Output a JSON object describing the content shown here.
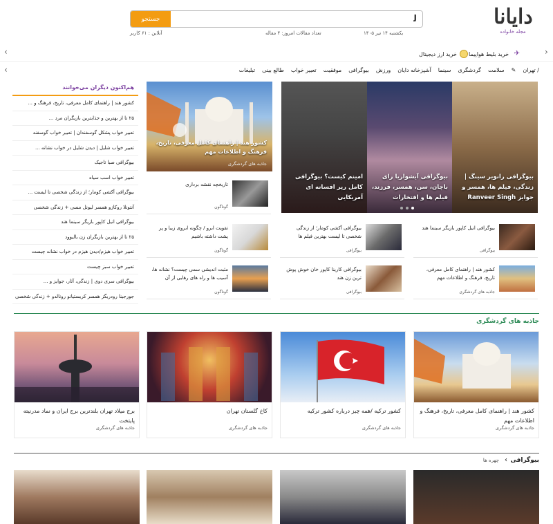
{
  "header": {
    "logo_text": "دایانا",
    "logo_subtitle": "مجله خانواده",
    "search_placeholder": "",
    "search_button": "جستجو",
    "date": "یکشنبه ۱۴ تیر ۱۴۰۵",
    "articles_today": "تعداد مقالات امروز: ۴ مقاله",
    "online": "آنلاین : ۶۱ کاربر"
  },
  "adbar": {
    "items": [
      "خرید بلیط هواپیما",
      "خرید ارز دیجیتال"
    ]
  },
  "nav": {
    "items": [
      "تهران /",
      "سلامت",
      "گردشگری",
      "سینما",
      "آشپزخانه دایان",
      "ورزش",
      "بیوگرافی",
      "موفقیت",
      "تعبیر خواب",
      "طالع بینی",
      "تبلیغات"
    ]
  },
  "slider": {
    "slides": [
      {
        "caption": "بیوگرافی رانویر سینگ | زندگی، فیلم ها، همسر و جوایز Ranveer Singh"
      },
      {
        "caption": "بیوگرافی آیشواریا رای باچان، سن، همسر، فرزند، فیلم ها و افتخارات"
      },
      {
        "caption": "امینم کیست؟ بیوگرافی کامل رپر افسانه ای آمریکایی"
      }
    ]
  },
  "feature": {
    "title": "کشور هند | راهنمای کامل معرفی، تاریخ، فرهنگ و اطلاعات مهم",
    "category": "جاذبه های گردشگری"
  },
  "cards": [
    {
      "title": "تاریخچه نقشه برداری",
      "category": "گوناگون"
    },
    {
      "title": "بیوگرافی انیل کاپور بازیگر سینما هند",
      "category": "بیوگرافی"
    },
    {
      "title": "بیوگرافی آکشی کومار؛ از زندگی شخصی تا لیست بهترین فیلم ها",
      "category": "بیوگرافی"
    },
    {
      "title": "تقویت ابرو / چگونه ابروی زیبا و پر پشت داشته باشیم",
      "category": "گوناگون"
    },
    {
      "title": "کشور هند | راهنمای کامل معرفی، تاریخ، فرهنگ و اطلاعات مهم",
      "category": "جاذبه های گردشگری"
    },
    {
      "title": "بیوگرافی کارینا کاپور خان خوش پوش ترین زن هند",
      "category": "بیوگرافی"
    },
    {
      "title": "مثبت اندیشی سمی چیست؟ نشانه ها، آسیب ها و راه های رهایی از آن",
      "category": "گوناگون"
    }
  ],
  "sidebar": {
    "title": "هم‌اکنون دیگران می‌خوانند",
    "items": [
      "کشور هند | راهنمای کامل معرفی، تاریخ، فرهنگ و ...",
      "۲۵ تا از بهترین و جذابترین بازیگران مرد ...",
      "تعبیر خواب پشکل گوسفندان | تعبیر خواب گوسفند",
      "تعبیر خواب شلیل | دیدن شلیل در خواب نشانه ...",
      "بیوگرافی صبا تاجیک",
      "تعبیر خواب اسب سیاه",
      "بیوگرافی آکشی کومار؛ از زندگی شخصی تا لیست ...",
      "آنتونلا روکازو همسر لیونل مسی + زندگی شخصی",
      "بیوگرافی انیل کاپور بازیگر سینما هند",
      "۲۵ تا از بهترین بازیگران زن بالیوود",
      "تعبیر خواب هیزم/دیدن هیزم در خواب نشانه چیست",
      "تعبیر خواب سبز چیست",
      "بیوگرافی سری دوی | زندگی، آثار، جوایز و ...",
      "جورجینا رودریگز همسر کریستیانو رونالدو + زندگی شخصی"
    ]
  },
  "tourism": {
    "title": "جاذبه های گردشگری",
    "cards": [
      {
        "title": "کشور هند | راهنمای کامل معرفی، تاریخ، فرهنگ و اطلاعات مهم",
        "category": "جاذبه های گردشگری"
      },
      {
        "title": "کشور ترکیه /همه چیز درباره کشور ترکیه",
        "category": "جاذبه های گردشگری"
      },
      {
        "title": "کاخ گلستان تهران",
        "category": "جاذبه های گردشگری"
      },
      {
        "title": "برج میلاد تهران بلندترین برج ایران و نماد مدرنیته پایتخت",
        "category": "جاذبه های گردشگری"
      }
    ]
  },
  "bio": {
    "title": "بیوگرافی",
    "sub": "چهره ها"
  }
}
